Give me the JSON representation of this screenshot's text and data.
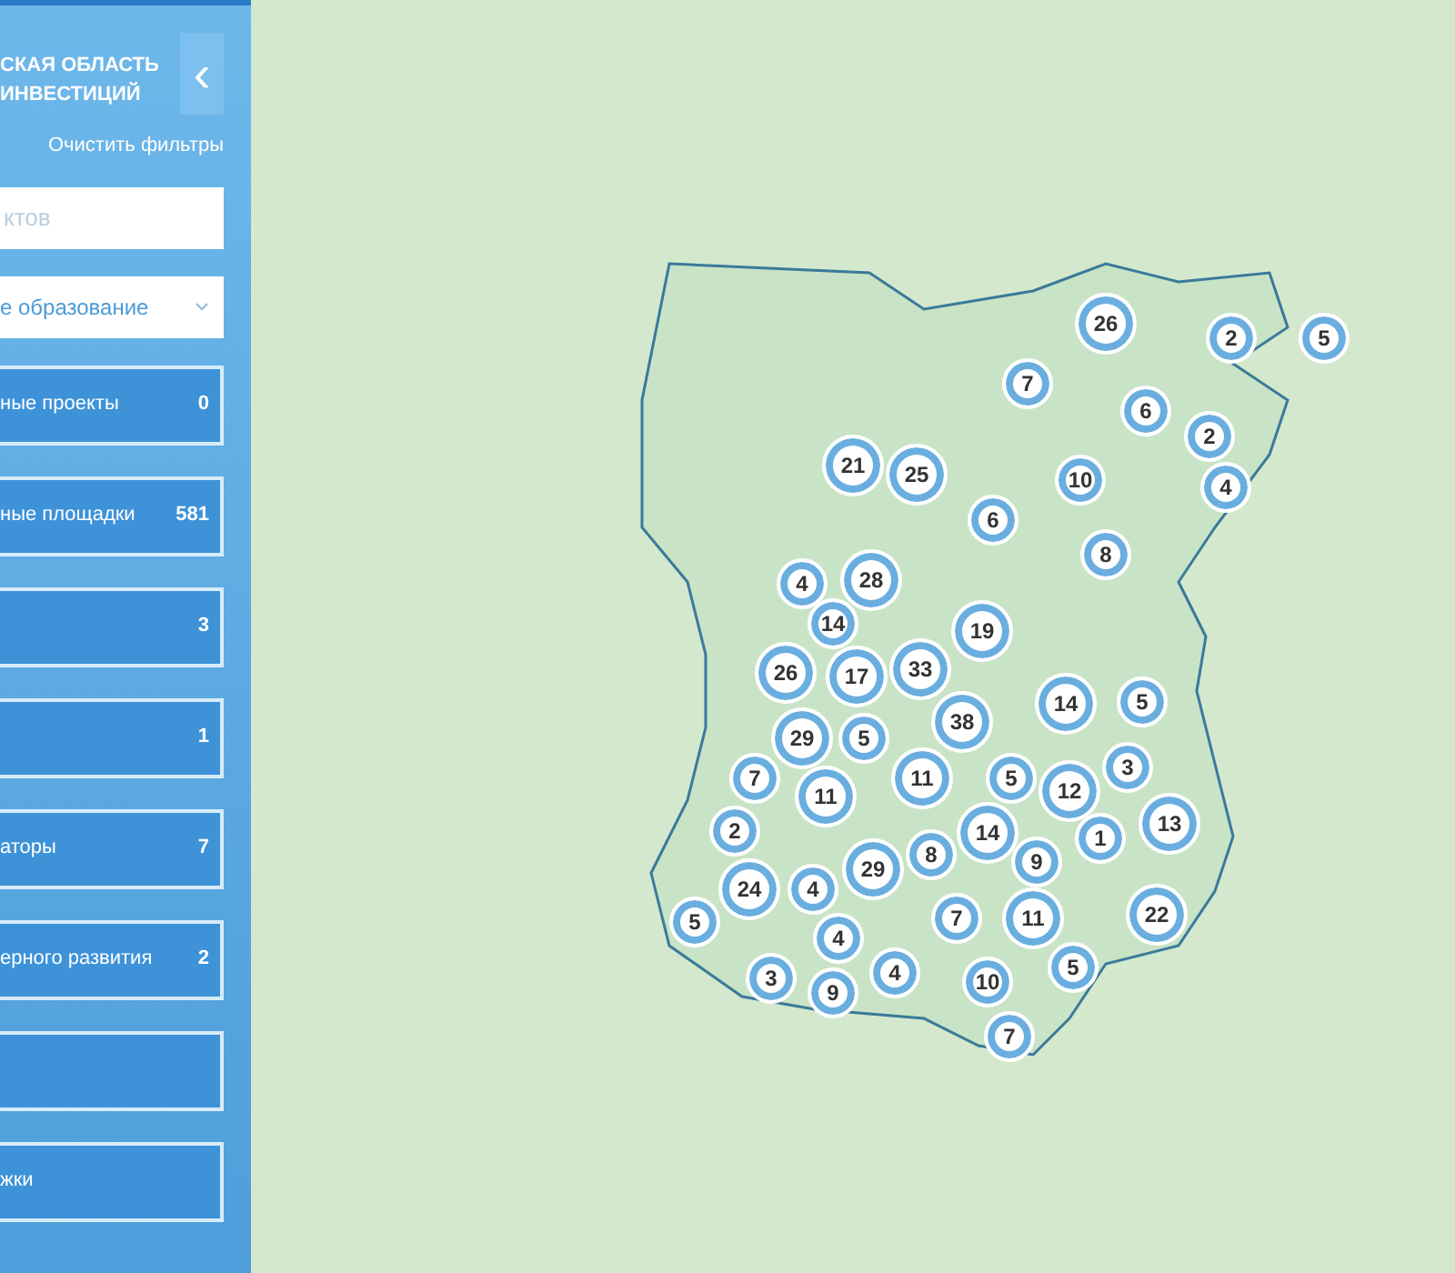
{
  "sidebar": {
    "title_lines": [
      "СКАЯ ОБЛАСТЬ",
      "ИНВЕСТИЦИЙ"
    ],
    "collapse_button": "‹",
    "clear_filters": "Очистить фильтры",
    "search": {
      "placeholder": "ктов"
    },
    "select": {
      "value": "е образование"
    },
    "categories": [
      {
        "kind": "filter",
        "label": "ные проекты",
        "count": "0"
      },
      {
        "kind": "filter",
        "label": "ные площадки",
        "count": "581"
      },
      {
        "kind": "filter",
        "count": "3"
      },
      {
        "kind": "filter",
        "count": "1"
      },
      {
        "kind": "filter",
        "label": "аторы",
        "count": "7"
      },
      {
        "kind": "filter",
        "label": "ерного развития",
        "count": "2"
      },
      {
        "kind": "blank"
      },
      {
        "kind": "filter",
        "label": "жки"
      }
    ]
  },
  "map": {
    "clusters": [
      "26",
      "2",
      "5",
      "7",
      "6",
      "2",
      "21",
      "25",
      "10",
      "4",
      "6",
      "8",
      "4",
      "28",
      "14",
      "19",
      "26",
      "17",
      "33",
      "14",
      "5",
      "38",
      "29",
      "5",
      "3",
      "7",
      "11",
      "5",
      "11",
      "12",
      "13",
      "2",
      "14",
      "1",
      "8",
      "9",
      "29",
      "24",
      "4",
      "5",
      "7",
      "11",
      "22",
      "4",
      "3",
      "4",
      "10",
      "5",
      "9",
      "7"
    ]
  }
}
